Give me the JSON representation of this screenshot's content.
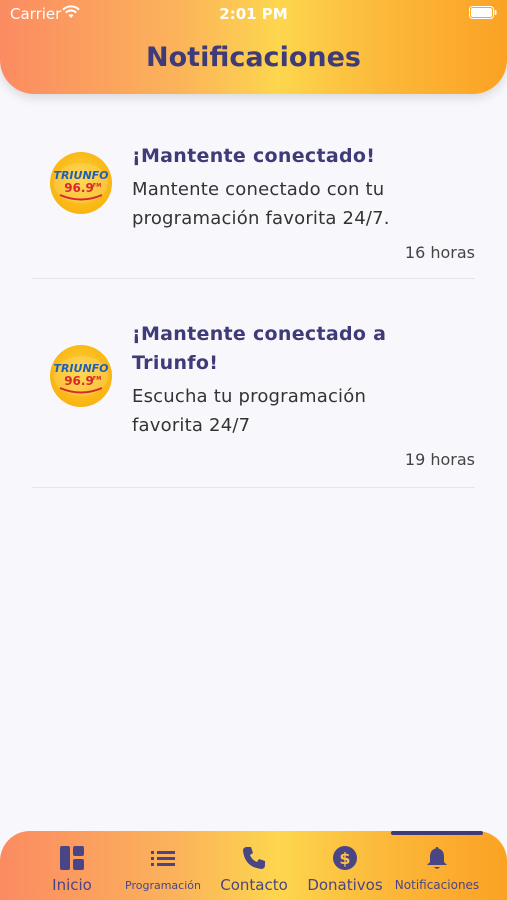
{
  "status_bar": {
    "carrier": "Carrier",
    "time": "2:01 PM"
  },
  "header": {
    "title": "Notificaciones"
  },
  "logo_text": {
    "line1": "TRIUNFO",
    "line2": "96.9",
    "suffix": "FM"
  },
  "notifications": [
    {
      "title_lines": [
        "¡Mantente conectado!"
      ],
      "body_lines": [
        "Mantente conectado con tu",
        "programación favorita 24/7."
      ],
      "time": "16 horas"
    },
    {
      "title_lines": [
        "¡Mantente conectado a",
        "Triunfo!"
      ],
      "body_lines": [
        "Escucha tu programación",
        "favorita 24/7"
      ],
      "time": "19 horas"
    }
  ],
  "tabs": [
    {
      "label": "Inicio",
      "icon": "grid-icon"
    },
    {
      "label": "Programación",
      "icon": "list-icon"
    },
    {
      "label": "Contacto",
      "icon": "phone-icon"
    },
    {
      "label": "Donativos",
      "icon": "dollar-icon"
    },
    {
      "label": "Notificaciones",
      "icon": "bell-icon"
    }
  ],
  "colors": {
    "accent": "#3f3a78",
    "gradient_start": "#fb8b62",
    "gradient_mid": "#fdd64e",
    "gradient_end": "#fba224"
  }
}
